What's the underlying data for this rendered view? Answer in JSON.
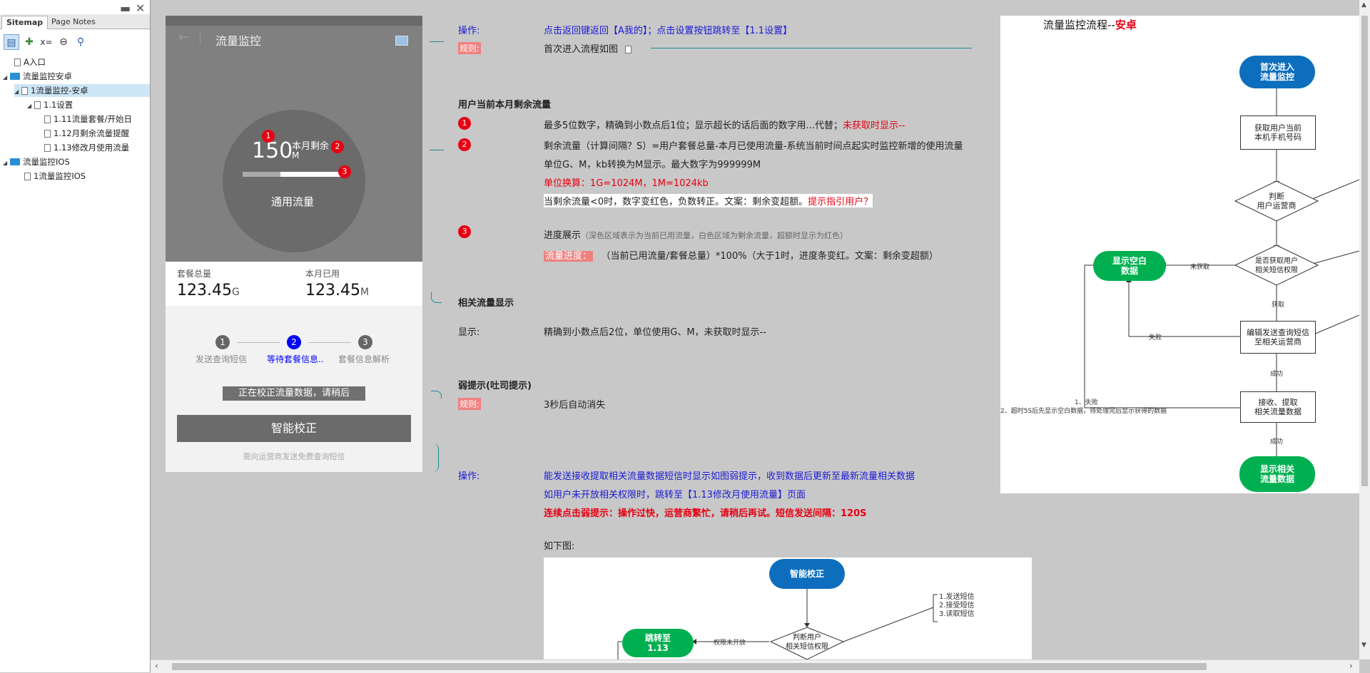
{
  "sidebar": {
    "tabs": [
      "Sitemap",
      "Page Notes"
    ],
    "minimize": "▬",
    "close": "✕",
    "tree": [
      {
        "label": "A入口",
        "level": 0,
        "kind": "page"
      },
      {
        "label": "流量监控安卓",
        "level": 0,
        "kind": "folder"
      },
      {
        "label": "1流量监控-安卓",
        "level": 1,
        "kind": "page",
        "selected": true
      },
      {
        "label": "1.1设置",
        "level": 2,
        "kind": "page"
      },
      {
        "label": "1.11流量套餐/开始日",
        "level": 3,
        "kind": "page"
      },
      {
        "label": "1.12月剩余流量提醒",
        "level": 3,
        "kind": "page"
      },
      {
        "label": "1.13修改月使用流量",
        "level": 3,
        "kind": "page"
      },
      {
        "label": "流量监控IOS",
        "level": 0,
        "kind": "folder"
      },
      {
        "label": "1流量监控IOS",
        "level": 1,
        "kind": "page"
      }
    ]
  },
  "phone": {
    "title": "流量监控",
    "big_number": "150",
    "remain_label": "本月剩余",
    "remain_unit": "M",
    "common_flow": "通用流量",
    "remaining_progress": 0.62,
    "stats": {
      "total_label": "套餐总量",
      "total_value": "123.45",
      "total_unit": "G",
      "used_label": "本月已用",
      "used_value": "123.45",
      "used_unit": "M"
    },
    "steps": [
      {
        "num": "1",
        "label": "发送查询短信"
      },
      {
        "num": "2",
        "label": "等待套餐信息.."
      },
      {
        "num": "3",
        "label": "套餐信息解析"
      }
    ],
    "checking": "正在校正流量数据，请稍后",
    "smart_button": "智能校正",
    "send_note": "需向运营商发送免费查询短信",
    "badges": [
      "1",
      "2",
      "3"
    ]
  },
  "annotations": {
    "op1_label": "操作:",
    "op1_text": "点击返回键返回【A我的】；点击设置按钮跳转至【1.1设置】",
    "rule1_label": "规则:",
    "rule1_text": "首次进入流程如图",
    "sec1_title": "用户当前本月剩余流量",
    "n1": "1",
    "n1_text": "最多5位数字，精确到小数点后1位；显示超长的话后面的数字用...代替；",
    "n1_red": "未获取时显示--",
    "n2": "2",
    "n2_line1": "剩余流量（计算间隔？S）=用户套餐总量-本月已使用流量-系统当前时间点起实时监控新增的使用流量",
    "n2_line2": "单位G、M，kb转换为M显示。最大数字为999999M",
    "n2_line3": "单位换算：1G=1024M，1M=1024kb",
    "n2_line4": "当剩余流量<0时，数字变红色，负数转正。文案：剩余变超额。",
    "n2_line4_red": "提示指引用户？",
    "n3": "3",
    "n3_line1": "进度展示",
    "n3_line1_small": "（深色区域表示为当前已用流量，白色区域为剩余流量，超额时显示为红色）",
    "n3_line2_label": "流量进度：",
    "n3_line2": "（当前已用流量/套餐总量）*100%（大于1时，进度条变红。文案：剩余变超额）",
    "sec2_title": "相关流量显示",
    "disp_label": "显示:",
    "disp_text": "精确到小数点后2位，单位使用G、M，未获取时显示--",
    "sec3_title": "弱提示(吐司提示)",
    "rule3_label": "规则:",
    "rule3_text": "3秒后自动消失",
    "op4_label": "操作:",
    "op4_line1": "能发送接收提取相关流量数据短信时显示如图弱提示，收到数据后更新至最新流量相关数据",
    "op4_line2": "如用户未开放相关权限时，跳转至【1.13修改月使用流量】页面",
    "op4_line3": "连续点击弱提示：操作过快，运营商繁忙，请稍后再试。短信发送间隔：120S",
    "below_label": "如下图:"
  },
  "flow1": {
    "title": "流量监控流程--",
    "title_red": "安卓",
    "start": "首次进入\n流量监控",
    "get_phone": "获取用户当前\n本机手机号码",
    "judge_op": "判断\n用户运营商",
    "perm": "是否获取用户\n相关短信权限",
    "not_got": "未获取",
    "show_blank": "显示空白\n数据",
    "got": "获取",
    "send_sms": "编辑发送查询短信\n至相关运营商",
    "fail": "失败",
    "success1": "成功",
    "receive": "接收、提取\n相关流量数据",
    "note1": "1、失败",
    "note2": "2、超时5S后先显示空白数据，待处理完后显示获得的数据",
    "success2": "成功",
    "show_data": "显示相关\n流量数据"
  },
  "flow2": {
    "start": "智能校正",
    "judge": "判断用户\n相关短信权限",
    "not_open": "权限未开放",
    "jump": "跳转至\n1.13",
    "steps": "1.发送短信\n2.接受短信\n3.读取短信"
  },
  "colors": {
    "blue_oval": "#0d6ebd",
    "green_oval": "#00b050",
    "red": "#e60012",
    "label_blue": "#1a1ad6"
  }
}
